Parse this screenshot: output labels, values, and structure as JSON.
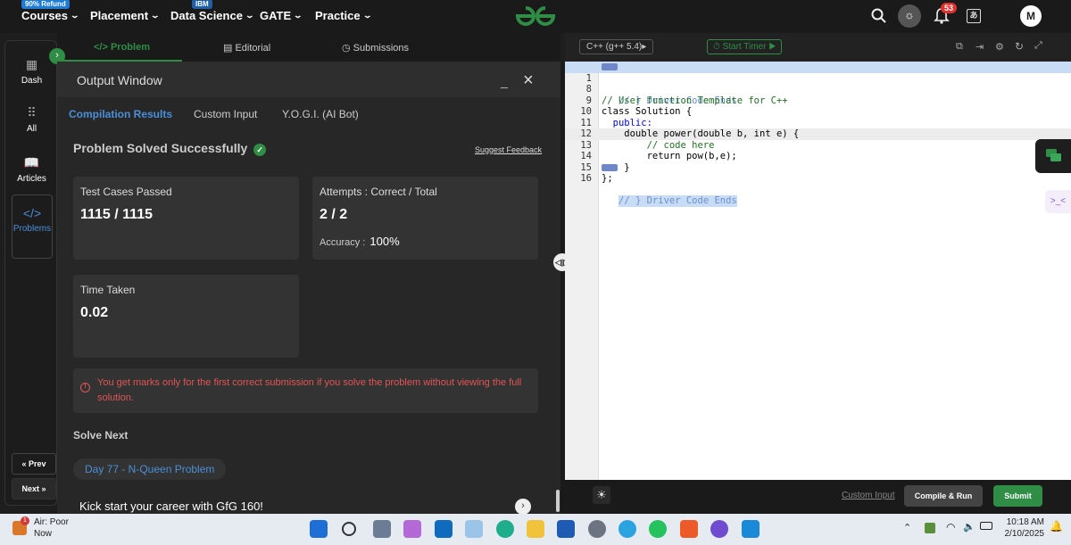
{
  "nav": {
    "courses": {
      "label": "Courses",
      "badge": "90% Refund",
      "badge_color": "#1f7cd6"
    },
    "placement": {
      "label": "Placement"
    },
    "data_science": {
      "label": "Data Science",
      "badge": "IBM",
      "badge_color": "#1f5fa6"
    },
    "gate": {
      "label": "GATE"
    },
    "practice": {
      "label": "Practice"
    },
    "notifications_count": "53",
    "avatar_letter": "M"
  },
  "problem_tabs": {
    "problem": "Problem",
    "editorial": "Editorial",
    "submissions": "Submissions"
  },
  "sidebar": {
    "items": [
      {
        "label": "Dash"
      },
      {
        "label": "All"
      },
      {
        "label": "Articles"
      },
      {
        "label": "Problems"
      }
    ],
    "prev": "« Prev",
    "next": "Next »"
  },
  "output": {
    "title": "Output Window",
    "tabs": [
      "Compilation Results",
      "Custom Input",
      "Y.O.G.I. (AI Bot)"
    ],
    "status": "Problem Solved Successfully",
    "feedback": "Suggest Feedback",
    "test_cases_label": "Test Cases Passed",
    "test_cases_value": "1115 / 1115",
    "attempts_label": "Attempts : Correct / Total",
    "attempts_value": "2 / 2",
    "accuracy_label": "Accuracy :",
    "accuracy_value": "100%",
    "time_label": "Time Taken",
    "time_value": "0.02",
    "warning": "You get marks only for the first correct submission if you solve the problem without viewing the full solution.",
    "solve_next_label": "Solve Next",
    "next_problem": "Day 77 - N-Queen Problem",
    "promo": "Kick start your career with GfG 160!"
  },
  "editor": {
    "language": "C++ (g++ 5.4)",
    "timer": "Start Timer",
    "lines": [
      {
        "n": "1",
        "code": "// } Driver Code Ends"
      },
      {
        "n": "8",
        "code": "// User function Template for C++"
      },
      {
        "n": "9",
        "code": "class Solution {"
      },
      {
        "n": "10",
        "code": "  public:"
      },
      {
        "n": "11",
        "code": "    double power(double b, int e) {"
      },
      {
        "n": "12",
        "code": "        // code here"
      },
      {
        "n": "13",
        "code": "        return pow(b,e);"
      },
      {
        "n": "14",
        "code": "    }"
      },
      {
        "n": "15",
        "code": "};"
      },
      {
        "n": "16",
        "code": "// } Driver Code Ends"
      }
    ]
  },
  "actions": {
    "custom_input": "Custom Input",
    "compile_run": "Compile & Run",
    "submit": "Submit"
  },
  "taskbar": {
    "weather_title": "Air: Poor",
    "weather_sub": "Now",
    "weather_badge": "1",
    "time": "10:18 AM",
    "date": "2/10/2025"
  },
  "colors": {
    "accent_green": "#2f8d46",
    "submit_green": "#2f8d46",
    "warning_red": "#e05555",
    "link_blue": "#4a8fd8"
  }
}
